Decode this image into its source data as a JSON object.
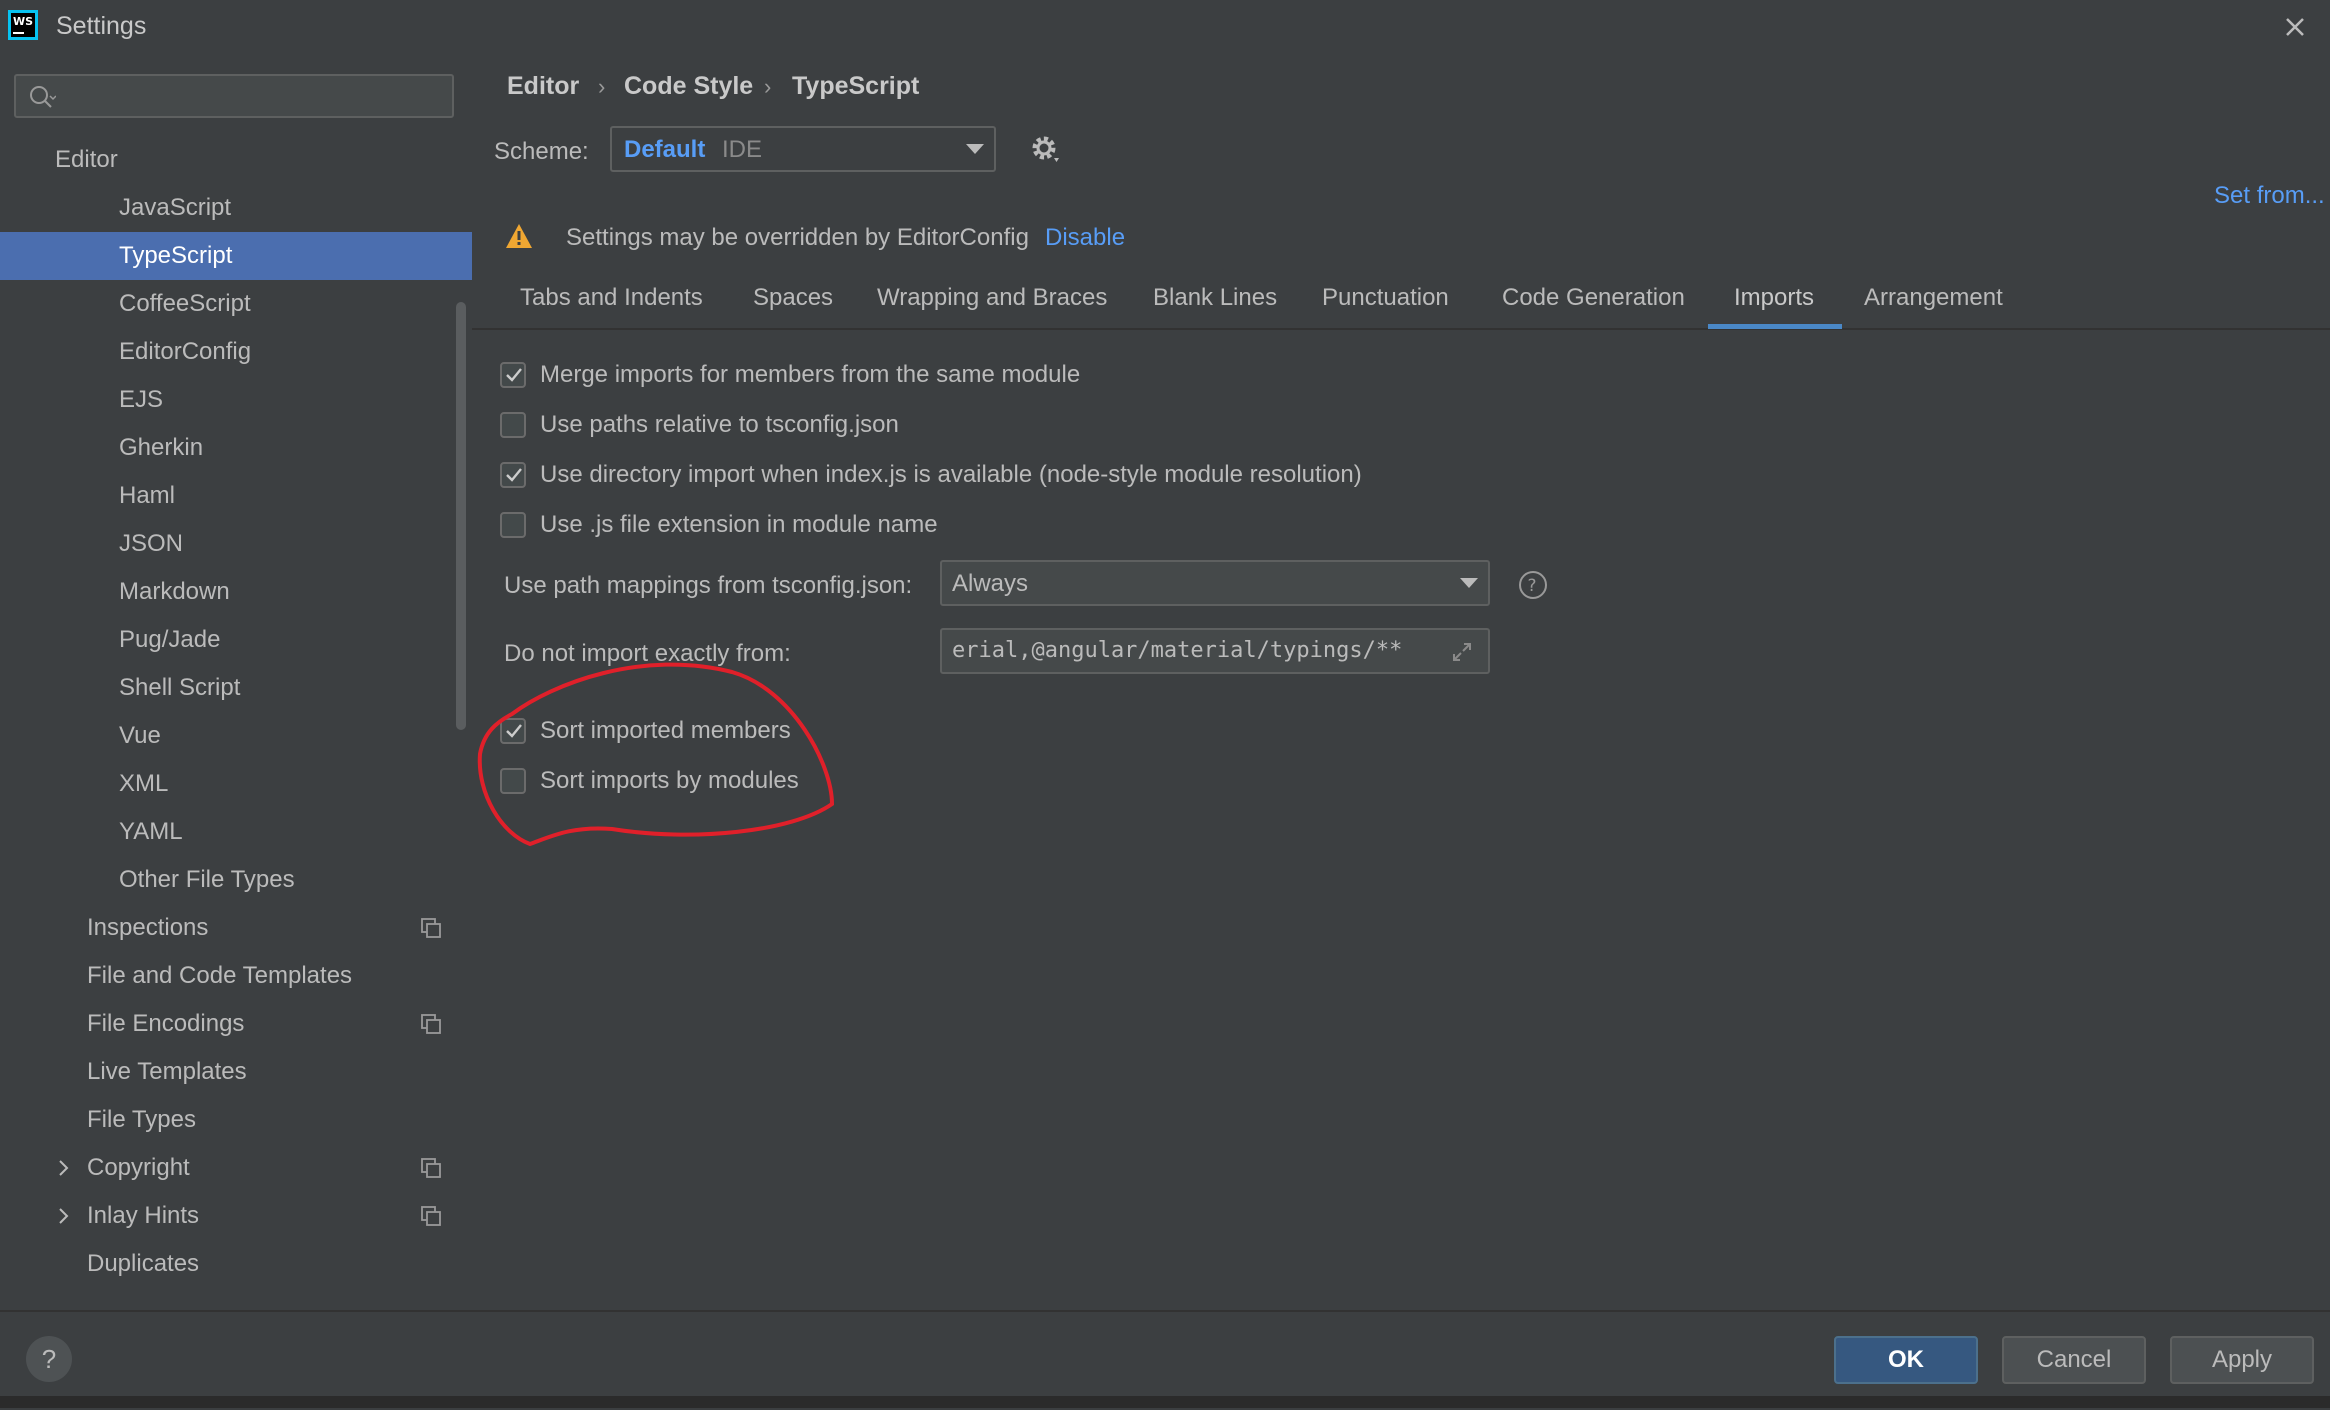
{
  "window": {
    "title": "Settings"
  },
  "sidebar": {
    "search_placeholder": "",
    "section_header": "Editor",
    "items": [
      {
        "label": "JavaScript"
      },
      {
        "label": "TypeScript",
        "selected": true
      },
      {
        "label": "CoffeeScript"
      },
      {
        "label": "EditorConfig"
      },
      {
        "label": "EJS"
      },
      {
        "label": "Gherkin"
      },
      {
        "label": "Haml"
      },
      {
        "label": "JSON"
      },
      {
        "label": "Markdown"
      },
      {
        "label": "Pug/Jade"
      },
      {
        "label": "Shell Script"
      },
      {
        "label": "Vue"
      },
      {
        "label": "XML"
      },
      {
        "label": "YAML"
      },
      {
        "label": "Other File Types"
      }
    ],
    "groups": [
      {
        "label": "Inspections",
        "copy_icon": true
      },
      {
        "label": "File and Code Templates"
      },
      {
        "label": "File Encodings",
        "copy_icon": true
      },
      {
        "label": "Live Templates"
      },
      {
        "label": "File Types"
      },
      {
        "label": "Copyright",
        "copy_icon": true,
        "expandable": true
      },
      {
        "label": "Inlay Hints",
        "copy_icon": true,
        "expandable": true
      },
      {
        "label": "Duplicates"
      }
    ]
  },
  "breadcrumb": [
    "Editor",
    "Code Style",
    "TypeScript"
  ],
  "scheme": {
    "label": "Scheme:",
    "name": "Default",
    "sub": "IDE"
  },
  "set_from": "Set from...",
  "warning": {
    "text": "Settings may be overridden by EditorConfig",
    "link": "Disable"
  },
  "tabs": [
    {
      "label": "Tabs and Indents"
    },
    {
      "label": "Spaces"
    },
    {
      "label": "Wrapping and Braces"
    },
    {
      "label": "Blank Lines"
    },
    {
      "label": "Punctuation"
    },
    {
      "label": "Code Generation"
    },
    {
      "label": "Imports",
      "active": true
    },
    {
      "label": "Arrangement"
    }
  ],
  "options": [
    {
      "label": "Merge imports for members from the same module",
      "checked": true
    },
    {
      "label": "Use paths relative to tsconfig.json",
      "checked": false
    },
    {
      "label": "Use directory import when index.js is available (node-style module resolution)",
      "checked": true
    },
    {
      "label": "Use .js file extension in module name",
      "checked": false
    }
  ],
  "path_mappings": {
    "label": "Use path mappings from tsconfig.json:",
    "value": "Always"
  },
  "do_not_import": {
    "label": "Do not import exactly from:",
    "value": "erial,@angular/material/typings/**"
  },
  "sort_options": [
    {
      "label": "Sort imported members",
      "checked": true
    },
    {
      "label": "Sort imports by modules",
      "checked": false
    }
  ],
  "footer": {
    "help": "?",
    "ok": "OK",
    "cancel": "Cancel",
    "apply": "Apply"
  },
  "colors": {
    "accent": "#589df6",
    "selection": "#4b6eaf",
    "annotation": "#e0202a"
  }
}
